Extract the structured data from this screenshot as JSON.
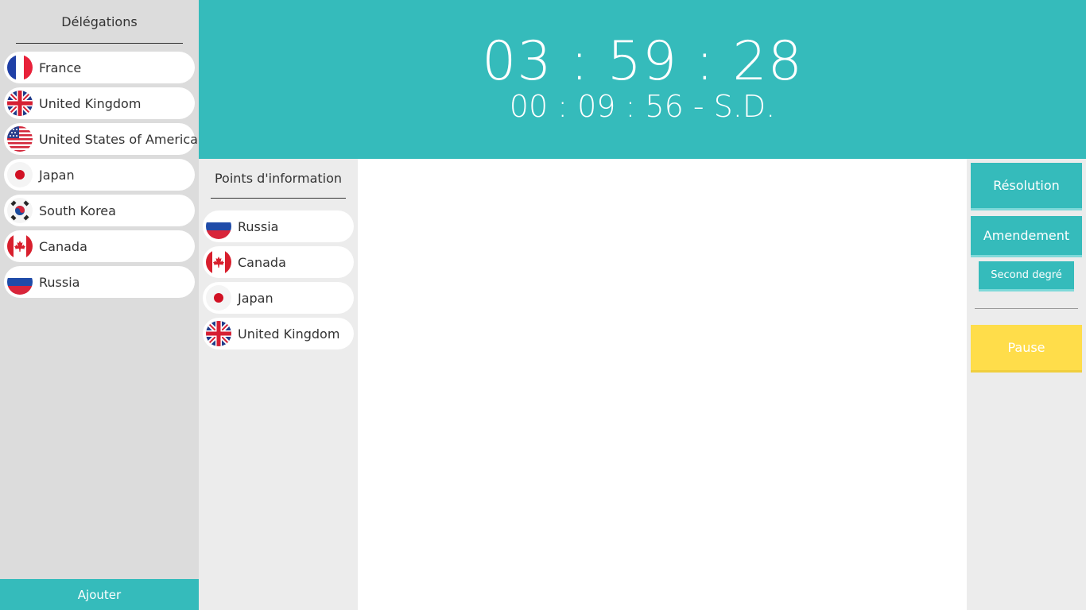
{
  "sidebar": {
    "title": "Délégations",
    "delegations": [
      {
        "name": "France",
        "flag": "france-flag"
      },
      {
        "name": "United Kingdom",
        "flag": "uk-flag"
      },
      {
        "name": "United States of America",
        "flag": "usa-flag"
      },
      {
        "name": "Japan",
        "flag": "japan-flag"
      },
      {
        "name": "South Korea",
        "flag": "south-korea-flag"
      },
      {
        "name": "Canada",
        "flag": "canada-flag"
      },
      {
        "name": "Russia",
        "flag": "russia-flag"
      }
    ],
    "add_label": "Ajouter"
  },
  "header": {
    "main_timer": "03 : 59 : 28",
    "sub_timer": "00 : 09 : 56 - S.D."
  },
  "points": {
    "title": "Points d'information",
    "items": [
      {
        "name": "Russia",
        "flag": "russia-flag"
      },
      {
        "name": "Canada",
        "flag": "canada-flag"
      },
      {
        "name": "Japan",
        "flag": "japan-flag"
      },
      {
        "name": "United Kingdom",
        "flag": "uk-flag"
      }
    ]
  },
  "actions": {
    "resolution_label": "Résolution",
    "amendement_label": "Amendement",
    "second_label": "Second degré",
    "pause_label": "Pause"
  },
  "colors": {
    "accent": "#35bbbb",
    "pause": "#ffdd4a",
    "sidebar_bg": "#dcdcdc",
    "panel_bg": "#ececec"
  }
}
